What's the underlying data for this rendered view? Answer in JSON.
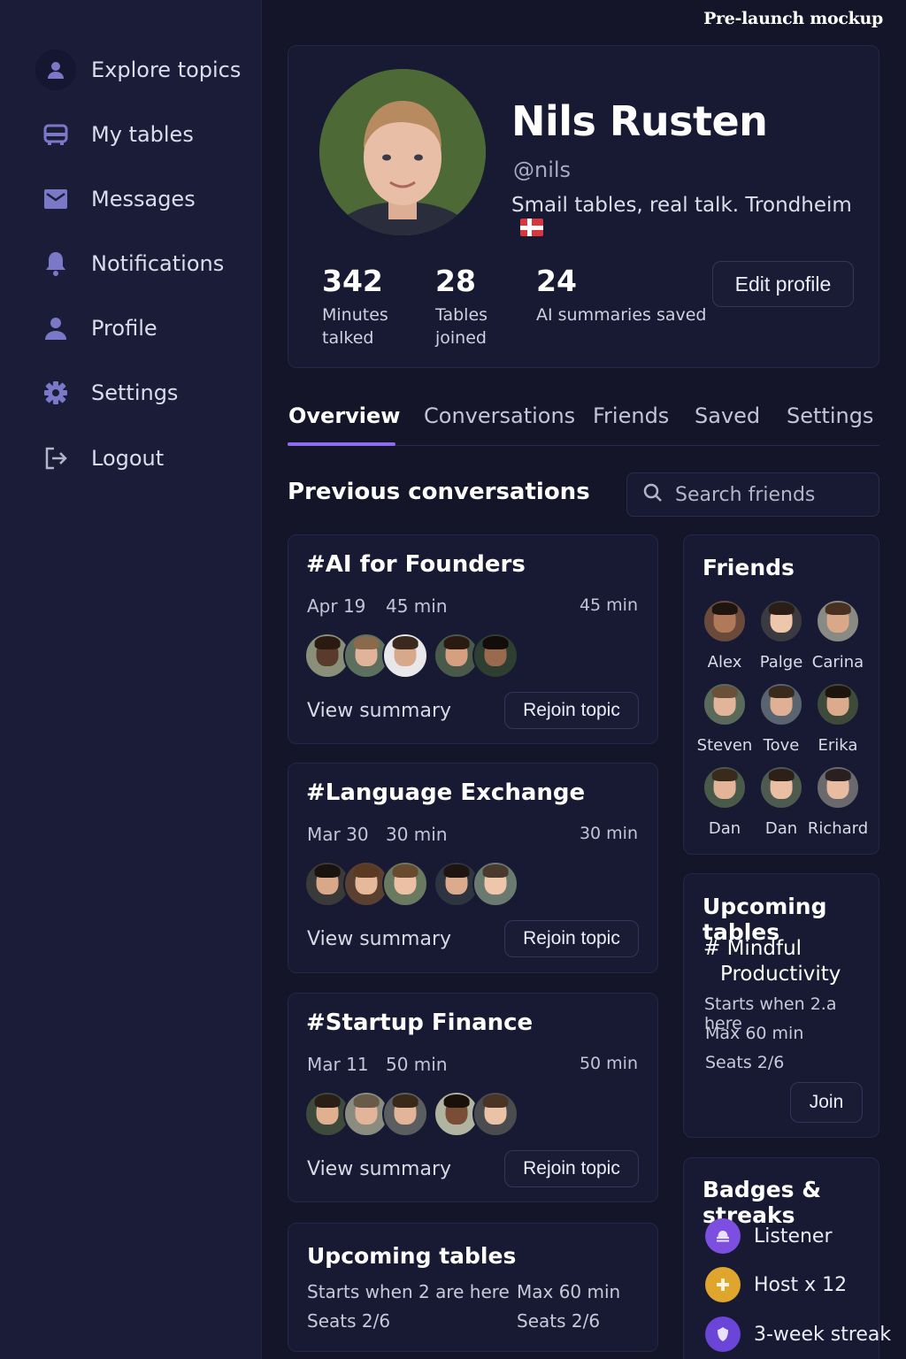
{
  "watermark": "Pre-launch mockup",
  "sidebar": {
    "items": [
      {
        "label": "Explore topics",
        "icon": "user-icon"
      },
      {
        "label": "My tables",
        "icon": "table-icon"
      },
      {
        "label": "Messages",
        "icon": "mail-icon"
      },
      {
        "label": "Notifications",
        "icon": "bell-icon"
      },
      {
        "label": "Profile",
        "icon": "profile-icon"
      },
      {
        "label": "Settings",
        "icon": "gear-icon"
      },
      {
        "label": "Logout",
        "icon": "logout-icon"
      }
    ],
    "accent": "#7b78c8"
  },
  "profile": {
    "name": "Nils Rusten",
    "handle": "@nils",
    "bio": "Smail tables, real talk. Trondheim",
    "stats": [
      {
        "value": "342",
        "label_1": "Minutes",
        "label_2": "talked"
      },
      {
        "value": "28",
        "label_1": "Tables",
        "label_2": "joined"
      },
      {
        "value": "24",
        "label_1": "AI summaries saved",
        "label_2": ""
      }
    ],
    "edit_label": "Edit profile"
  },
  "tabs": [
    "Overview",
    "Conversations",
    "Friends",
    "Saved",
    "Settings"
  ],
  "tab_accent": "#8b6cf0",
  "main": {
    "section_title": "Previous conversations",
    "search_placeholder": "Search friends"
  },
  "conversations": [
    {
      "title": "#AI for Founders",
      "date": "Apr 19",
      "duration": "45 min",
      "duration_right": "45 min",
      "view": "View summary",
      "rejoin": "Rejoin topic"
    },
    {
      "title": "#Language Exchange",
      "date": "Mar 30",
      "duration": "30 min",
      "duration_right": "30 min",
      "view": "View summary",
      "rejoin": "Rejoin topic"
    },
    {
      "title": "#Startup Finance",
      "date": "Mar 11",
      "duration": "50 min",
      "duration_right": "50 min",
      "view": "View summary",
      "rejoin": "Rejoin topic"
    }
  ],
  "upcoming_bottom": {
    "title": "Upcoming tables",
    "left_1": "Starts when 2 are here",
    "left_2": "Seats 2/6",
    "right_1": "Max 60 min",
    "right_2": "Seats 2/6"
  },
  "friends": {
    "title": "Friends",
    "list": [
      "Alex",
      "Palge",
      "Carina",
      "Steven",
      "Tove",
      "Erika",
      "Dan",
      "Dan",
      "Richard"
    ]
  },
  "upcoming": {
    "title": "Upcoming tables",
    "topic_1": "# Mindful",
    "topic_2": "Productivity",
    "starts": "Starts when 2.a here",
    "max": "Max 60 min",
    "seats": "Seats 2/6",
    "join": "Join"
  },
  "badges": {
    "title": "Badges & streaks",
    "items": [
      {
        "label": "Listener",
        "color": "#7c4fe0",
        "icon": "bell-badge-icon"
      },
      {
        "label": "Host x 12",
        "color": "#e0a52c",
        "icon": "plus-badge-icon"
      },
      {
        "label": "3-week streak",
        "color": "#6a45d8",
        "icon": "shield-badge-icon"
      }
    ]
  }
}
